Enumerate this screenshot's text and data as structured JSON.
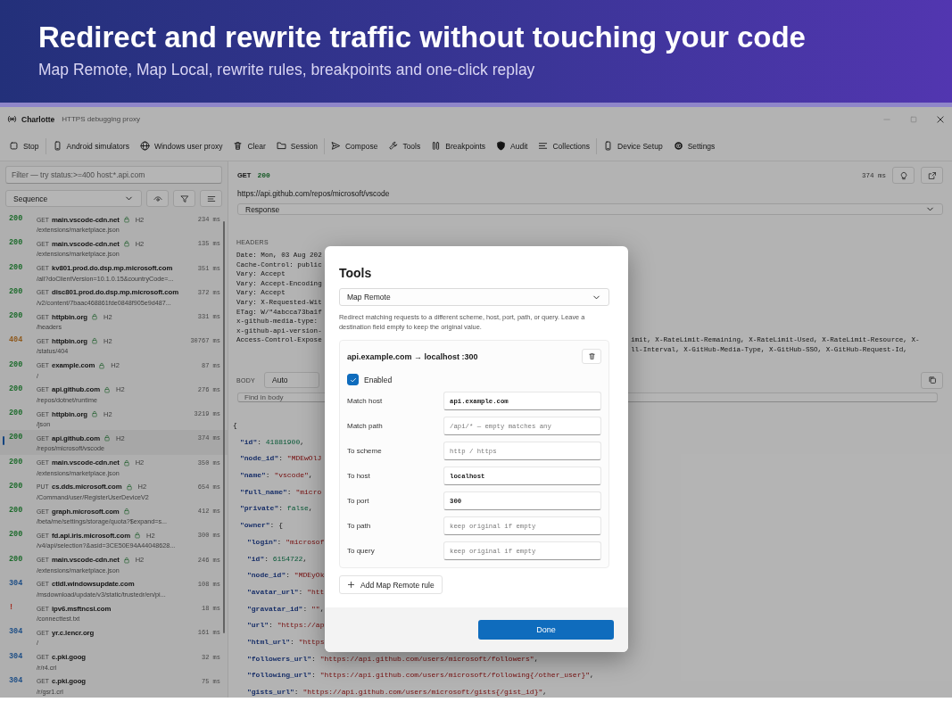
{
  "banner": {
    "title": "Redirect and rewrite traffic without touching your code",
    "subtitle": "Map Remote, Map Local, rewrite rules, breakpoints and one-click replay"
  },
  "window": {
    "title": "Charlotte",
    "subtitle": "HTTPS debugging proxy"
  },
  "toolbar": [
    {
      "label": "Stop",
      "separator_before": false
    },
    {
      "label": "Android simulators",
      "separator_before": true
    },
    {
      "label": "Windows user proxy",
      "separator_before": false
    },
    {
      "label": "Clear",
      "separator_before": false
    },
    {
      "label": "Session",
      "separator_before": false
    },
    {
      "label": "Compose",
      "separator_before": true
    },
    {
      "label": "Tools",
      "separator_before": false
    },
    {
      "label": "Breakpoints",
      "separator_before": false
    },
    {
      "label": "Audit",
      "separator_before": false
    },
    {
      "label": "Collections",
      "separator_before": false
    },
    {
      "label": "Device Setup",
      "separator_before": true
    },
    {
      "label": "Settings",
      "separator_before": false
    }
  ],
  "left": {
    "filter_placeholder": "Filter — try status:>=400 host:*.api.com",
    "sort": "Sequence",
    "requests": [
      {
        "status": "200",
        "color": "#1d6b2c",
        "method": "GET",
        "host": "main.vscode-cdn.net",
        "secure": true,
        "protocol": "H2",
        "path": "/extensions/marketplace.json",
        "time": "234 ms",
        "selected": false
      },
      {
        "status": "200",
        "color": "#1d6b2c",
        "method": "GET",
        "host": "main.vscode-cdn.net",
        "secure": true,
        "protocol": "H2",
        "path": "/extensions/marketplace.json",
        "time": "135 ms",
        "selected": false
      },
      {
        "status": "200",
        "color": "#1d6b2c",
        "method": "GET",
        "host": "kv801.prod.do.dsp.mp.microsoft.com",
        "secure": false,
        "path": "/all?doClientVersion=10.1.0.15&countryCode=...",
        "time": "351 ms",
        "selected": false
      },
      {
        "status": "200",
        "color": "#1d6b2c",
        "method": "GET",
        "host": "disc801.prod.do.dsp.mp.microsoft.com",
        "secure": false,
        "path": "/v2/content/7baac468861fde0848f905e9d487...",
        "time": "372 ms",
        "selected": false
      },
      {
        "status": "200",
        "color": "#1d6b2c",
        "method": "GET",
        "host": "httpbin.org",
        "secure": true,
        "protocol": "H2",
        "path": "/headers",
        "time": "331 ms",
        "selected": false
      },
      {
        "status": "404",
        "color": "#8f5a1e",
        "method": "GET",
        "host": "httpbin.org",
        "secure": true,
        "protocol": "H2",
        "path": "/status/404",
        "time": "30767 ms",
        "selected": false
      },
      {
        "status": "200",
        "color": "#1d6b2c",
        "method": "GET",
        "host": "example.com",
        "secure": true,
        "protocol": "H2",
        "path": "/",
        "time": "87 ms",
        "selected": false
      },
      {
        "status": "200",
        "color": "#1d6b2c",
        "method": "GET",
        "host": "api.github.com",
        "secure": true,
        "protocol": "H2",
        "path": "/repos/dotnet/runtime",
        "time": "276 ms",
        "selected": false
      },
      {
        "status": "200",
        "color": "#1d6b2c",
        "method": "GET",
        "host": "httpbin.org",
        "secure": true,
        "protocol": "H2",
        "path": "/json",
        "time": "3219 ms",
        "selected": false
      },
      {
        "status": "200",
        "color": "#1d6b2c",
        "method": "GET",
        "host": "api.github.com",
        "secure": true,
        "protocol": "H2",
        "path": "/repos/microsoft/vscode",
        "time": "374 ms",
        "selected": true
      },
      {
        "status": "200",
        "color": "#1d6b2c",
        "method": "GET",
        "host": "main.vscode-cdn.net",
        "secure": true,
        "protocol": "H2",
        "path": "/extensions/marketplace.json",
        "time": "350 ms",
        "selected": false
      },
      {
        "status": "200",
        "color": "#1d6b2c",
        "method": "PUT",
        "host": "cs.dds.microsoft.com",
        "secure": true,
        "protocol": "H2",
        "path": "/Command/user/RegisterUserDeviceV2",
        "time": "654 ms",
        "selected": false
      },
      {
        "status": "200",
        "color": "#1d6b2c",
        "method": "GET",
        "host": "graph.microsoft.com",
        "secure": true,
        "path": "/beta/me/settings/storage/quota?$expand=s...",
        "time": "412 ms",
        "selected": false
      },
      {
        "status": "200",
        "color": "#1d6b2c",
        "method": "GET",
        "host": "fd.api.iris.microsoft.com",
        "secure": true,
        "protocol": "H2",
        "path": "/v4/api/selection?&asid=3CE50E94A44048628...",
        "time": "300 ms",
        "selected": false
      },
      {
        "status": "200",
        "color": "#1d6b2c",
        "method": "GET",
        "host": "main.vscode-cdn.net",
        "secure": true,
        "protocol": "H2",
        "path": "/extensions/marketplace.json",
        "time": "246 ms",
        "selected": false
      },
      {
        "status": "304",
        "color": "#1f4f86",
        "method": "GET",
        "host": "ctldl.windowsupdate.com",
        "secure": false,
        "path": "/msdownload/update/v3/static/trustedr/en/pi...",
        "time": "108 ms",
        "selected": false
      },
      {
        "status": "!",
        "color": "#a32a1e",
        "method": "GET",
        "host": "ipv6.msftncsi.com",
        "secure": false,
        "path": "/connecttest.txt",
        "time": "18 ms",
        "selected": false
      },
      {
        "status": "304",
        "color": "#1f4f86",
        "method": "GET",
        "host": "yr.c.lencr.org",
        "secure": false,
        "path": "/",
        "time": "161 ms",
        "selected": false
      },
      {
        "status": "304",
        "color": "#1f4f86",
        "method": "GET",
        "host": "c.pki.goog",
        "secure": false,
        "path": "/r/r4.crl",
        "time": "32 ms",
        "selected": false
      },
      {
        "status": "304",
        "color": "#1f4f86",
        "method": "GET",
        "host": "c.pki.goog",
        "secure": false,
        "path": "/r/gsr1.crl",
        "time": "75 ms",
        "selected": false
      }
    ]
  },
  "detail": {
    "method": "GET",
    "status": "200",
    "time": "374 ms",
    "url": "https://api.github.com/repos/microsoft/vscode",
    "section": "Response",
    "headers_label": "HEADERS",
    "header_lines": [
      {
        "left": "Date: Mon, 03 Aug 202"
      },
      {
        "left": "Cache-Control: public"
      },
      {
        "left": "Vary: Accept"
      },
      {
        "left": "Vary: Accept-Encoding"
      },
      {
        "left": "Vary: Accept"
      },
      {
        "left": "Vary: X-Requested-Wit"
      },
      {
        "left": "ETag: W/\"4abcca73ba1f"
      },
      {
        "left": "x-github-media-type:"
      },
      {
        "left": "x-github-api-version-"
      },
      {
        "left": "Access-Control-Expose",
        "right": "imit, X-RateLimit-Remaining, X-RateLimit-Used, X-RateLimit-Resource, X-"
      },
      {
        "right": "ll-Interval, X-GitHub-Media-Type, X-GitHub-SSO, X-GitHub-Request-Id,"
      }
    ],
    "body_label": "BODY",
    "body_format": "Auto",
    "find_placeholder": "Find in body",
    "body_lines": [
      {
        "parts": [
          {
            "kind": "punct",
            "text": "{"
          }
        ],
        "children": [
          {
            "parts": [
              {
                "kind": "key",
                "text": "\"id\""
              },
              {
                "kind": "punct",
                "text": ": "
              },
              {
                "kind": "num",
                "text": "41881900"
              },
              {
                "kind": "punct",
                "text": ","
              }
            ]
          },
          {
            "parts": [
              {
                "kind": "key",
                "text": "\"node_id\""
              },
              {
                "kind": "punct",
                "text": ": "
              },
              {
                "kind": "str",
                "text": "\"MDEwOlJ"
              }
            ]
          },
          {
            "parts": [
              {
                "kind": "key",
                "text": "\"name\""
              },
              {
                "kind": "punct",
                "text": ": "
              },
              {
                "kind": "str",
                "text": "\"vscode\""
              },
              {
                "kind": "punct",
                "text": ","
              }
            ]
          },
          {
            "parts": [
              {
                "kind": "key",
                "text": "\"full_name\""
              },
              {
                "kind": "punct",
                "text": ": "
              },
              {
                "kind": "str",
                "text": "\"micro"
              }
            ]
          },
          {
            "parts": [
              {
                "kind": "key",
                "text": "\"private\""
              },
              {
                "kind": "punct",
                "text": ": "
              },
              {
                "kind": "num",
                "text": "false"
              },
              {
                "kind": "punct",
                "text": ","
              }
            ]
          },
          {
            "parts": [
              {
                "kind": "key",
                "text": "\"owner\""
              },
              {
                "kind": "punct",
                "text": ": {"
              }
            ],
            "children": [
              {
                "parts": [
                  {
                    "kind": "key",
                    "text": "\"login\""
                  },
                  {
                    "kind": "punct",
                    "text": ": "
                  },
                  {
                    "kind": "str",
                    "text": "\"microsof"
                  }
                ]
              },
              {
                "parts": [
                  {
                    "kind": "key",
                    "text": "\"id\""
                  },
                  {
                    "kind": "punct",
                    "text": ": "
                  },
                  {
                    "kind": "num",
                    "text": "6154722"
                  },
                  {
                    "kind": "punct",
                    "text": ","
                  }
                ]
              },
              {
                "parts": [
                  {
                    "kind": "key",
                    "text": "\"node_id\""
                  },
                  {
                    "kind": "punct",
                    "text": ": "
                  },
                  {
                    "kind": "str",
                    "text": "\"MDEyOk"
                  }
                ]
              },
              {
                "parts": [
                  {
                    "kind": "key",
                    "text": "\"avatar_url\""
                  },
                  {
                    "kind": "punct",
                    "text": ": "
                  },
                  {
                    "kind": "str",
                    "text": "\"htt"
                  }
                ]
              },
              {
                "parts": [
                  {
                    "kind": "key",
                    "text": "\"gravatar_id\""
                  },
                  {
                    "kind": "punct",
                    "text": ": "
                  },
                  {
                    "kind": "str",
                    "text": "\"\""
                  },
                  {
                    "kind": "punct",
                    "text": ","
                  }
                ]
              },
              {
                "parts": [
                  {
                    "kind": "key",
                    "text": "\"url\""
                  },
                  {
                    "kind": "punct",
                    "text": ": "
                  },
                  {
                    "kind": "str",
                    "text": "\"https://ap"
                  }
                ]
              },
              {
                "parts": [
                  {
                    "kind": "key",
                    "text": "\"html_url\""
                  },
                  {
                    "kind": "punct",
                    "text": ": "
                  },
                  {
                    "kind": "str",
                    "text": "\"https"
                  }
                ]
              },
              {
                "parts": [
                  {
                    "kind": "key",
                    "text": "\"followers_url\""
                  },
                  {
                    "kind": "punct",
                    "text": ": "
                  },
                  {
                    "kind": "str",
                    "text": "\"https://api.github.com/users/microsoft/followers\""
                  },
                  {
                    "kind": "punct",
                    "text": ","
                  }
                ]
              },
              {
                "parts": [
                  {
                    "kind": "key",
                    "text": "\"following_url\""
                  },
                  {
                    "kind": "punct",
                    "text": ": "
                  },
                  {
                    "kind": "str",
                    "text": "\"https://api.github.com/users/microsoft/following{/other_user}\""
                  },
                  {
                    "kind": "punct",
                    "text": ","
                  }
                ]
              },
              {
                "parts": [
                  {
                    "kind": "key",
                    "text": "\"gists_url\""
                  },
                  {
                    "kind": "punct",
                    "text": ": "
                  },
                  {
                    "kind": "str",
                    "text": "\"https://api.github.com/users/microsoft/gists{/gist_id}\""
                  },
                  {
                    "kind": "punct",
                    "text": ","
                  }
                ]
              }
            ]
          }
        ]
      }
    ]
  },
  "modal": {
    "title": "Tools",
    "tool": "Map Remote",
    "description": "Redirect matching requests to a different scheme, host, port, path, or query. Leave a destination field empty to keep the original value.",
    "rule": {
      "title": "api.example.com → localhost :300",
      "enabled": true,
      "enabled_label": "Enabled",
      "fields": [
        {
          "label": "Match host",
          "value": "api.example.com"
        },
        {
          "label": "Match path",
          "placeholder": "/api/* — empty matches any"
        },
        {
          "label": "To scheme",
          "placeholder": "http / https"
        },
        {
          "label": "To host",
          "value": "localhost"
        },
        {
          "label": "To port",
          "value": "300"
        },
        {
          "label": "To path",
          "placeholder": "keep original if empty"
        },
        {
          "label": "To query",
          "placeholder": "keep original if empty"
        }
      ]
    },
    "add_label": "Add Map Remote rule",
    "done_label": "Done"
  }
}
